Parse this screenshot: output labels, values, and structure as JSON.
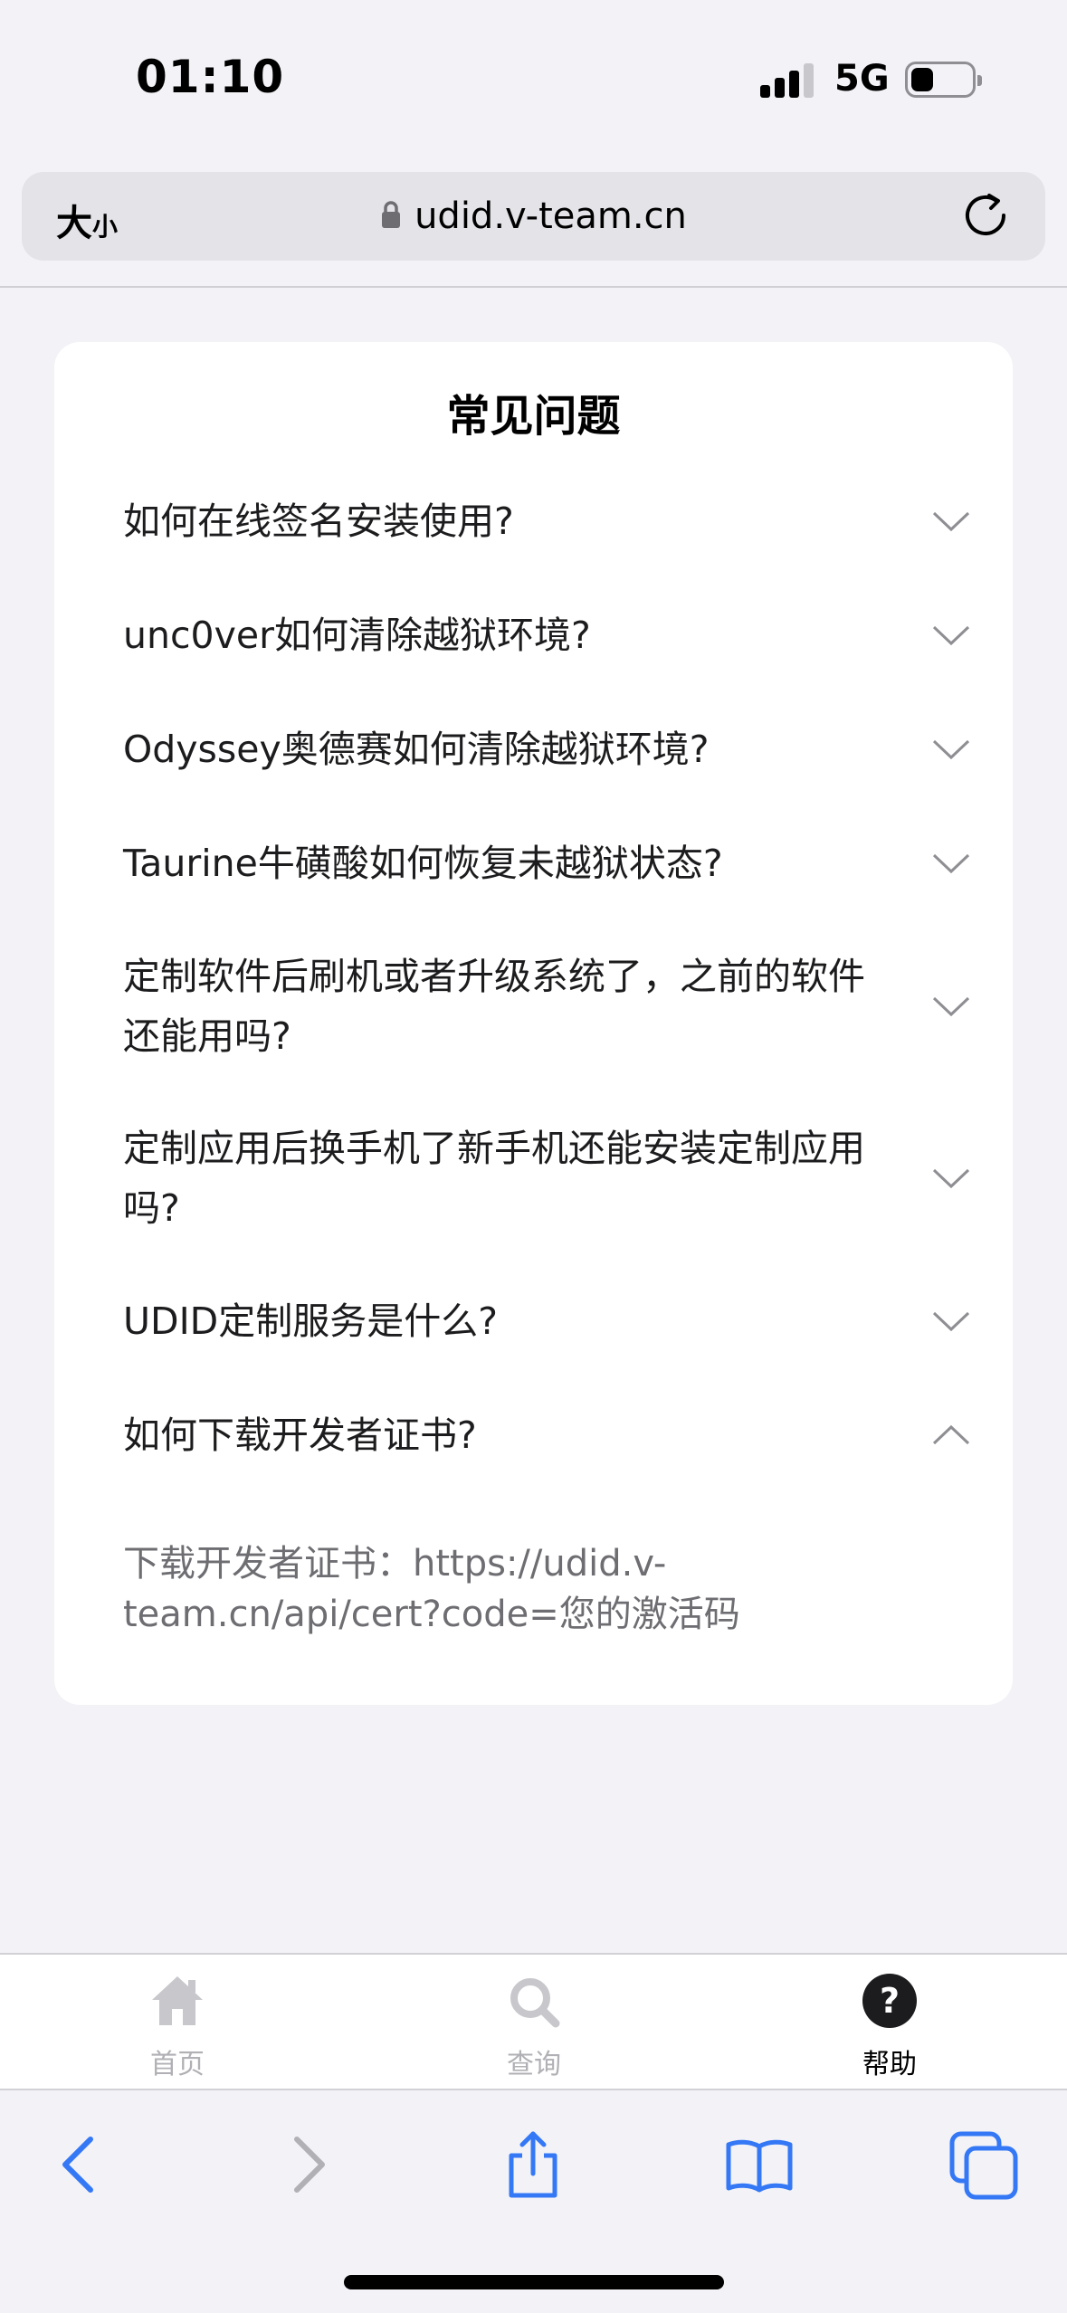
{
  "status": {
    "time": "01:10",
    "network": "5G"
  },
  "browser": {
    "text_size_big": "大",
    "text_size_small": "小",
    "url": "udid.v-team.cn"
  },
  "faq": {
    "title": "常见问题",
    "items": [
      {
        "question": "如何在线签名安装使用?",
        "expanded": false
      },
      {
        "question": "unc0ver如何清除越狱环境?",
        "expanded": false
      },
      {
        "question": "Odyssey奥德赛如何清除越狱环境?",
        "expanded": false
      },
      {
        "question": "Taurine牛磺酸如何恢复未越狱状态?",
        "expanded": false
      },
      {
        "question": "定制软件后刷机或者升级系统了，之前的软件还能用吗?",
        "expanded": false
      },
      {
        "question": "定制应用后换手机了新手机还能安装定制应用吗?",
        "expanded": false
      },
      {
        "question": "UDID定制服务是什么?",
        "expanded": false
      },
      {
        "question": "如何下载开发者证书?",
        "expanded": true
      }
    ],
    "answer": "下载开发者证书：https://udid.v-team.cn/api/cert?code=您的激活码"
  },
  "tabs": [
    {
      "label": "首页",
      "icon": "home-icon",
      "active": false
    },
    {
      "label": "查询",
      "icon": "search-icon",
      "active": false
    },
    {
      "label": "帮助",
      "icon": "help-icon",
      "active": true
    }
  ],
  "colors": {
    "accent": "#3478f6",
    "active_tab": "#1c1c1e",
    "inactive_tab": "#c7c7cc"
  }
}
